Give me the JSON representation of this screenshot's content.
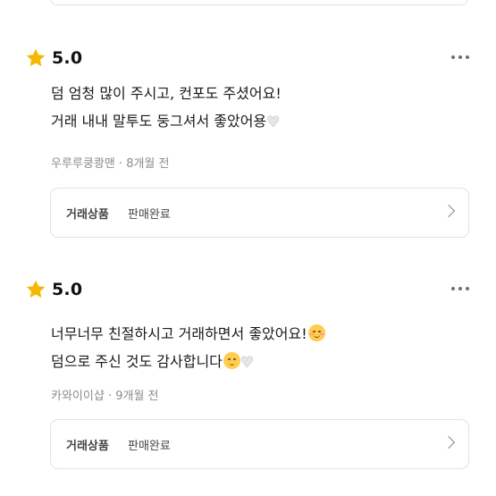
{
  "reviews": [
    {
      "score": "5.0",
      "lines": [
        "덤 엄청 많이 주시고, 컨포도 주셨어요!",
        "거래 내내 말투도 둥그셔서 좋았어용"
      ],
      "author": "우루루쿵쾅맨",
      "separator": "·",
      "time": "8개월 전",
      "product_label": "거래상품",
      "product_status": "판매완료"
    },
    {
      "score": "5.0",
      "lines": [
        "너무너무 친절하시고 거래하면서 좋았어요!",
        "덤으로 주신 것도 감사합니다"
      ],
      "author": "카와이이샵",
      "separator": "·",
      "time": "9개월 전",
      "product_label": "거래상품",
      "product_status": "판매완료"
    }
  ],
  "icons": {
    "star": "star-icon",
    "more": "more-icon",
    "chevron": "chevron-right-icon",
    "heart": "white-heart-icon",
    "smile": "smiling-face-icon",
    "pleading": "pleading-face-icon"
  },
  "colors": {
    "star": "#f5b800",
    "meta_text": "#8c8c8c",
    "card_border": "#e3e3e3"
  }
}
